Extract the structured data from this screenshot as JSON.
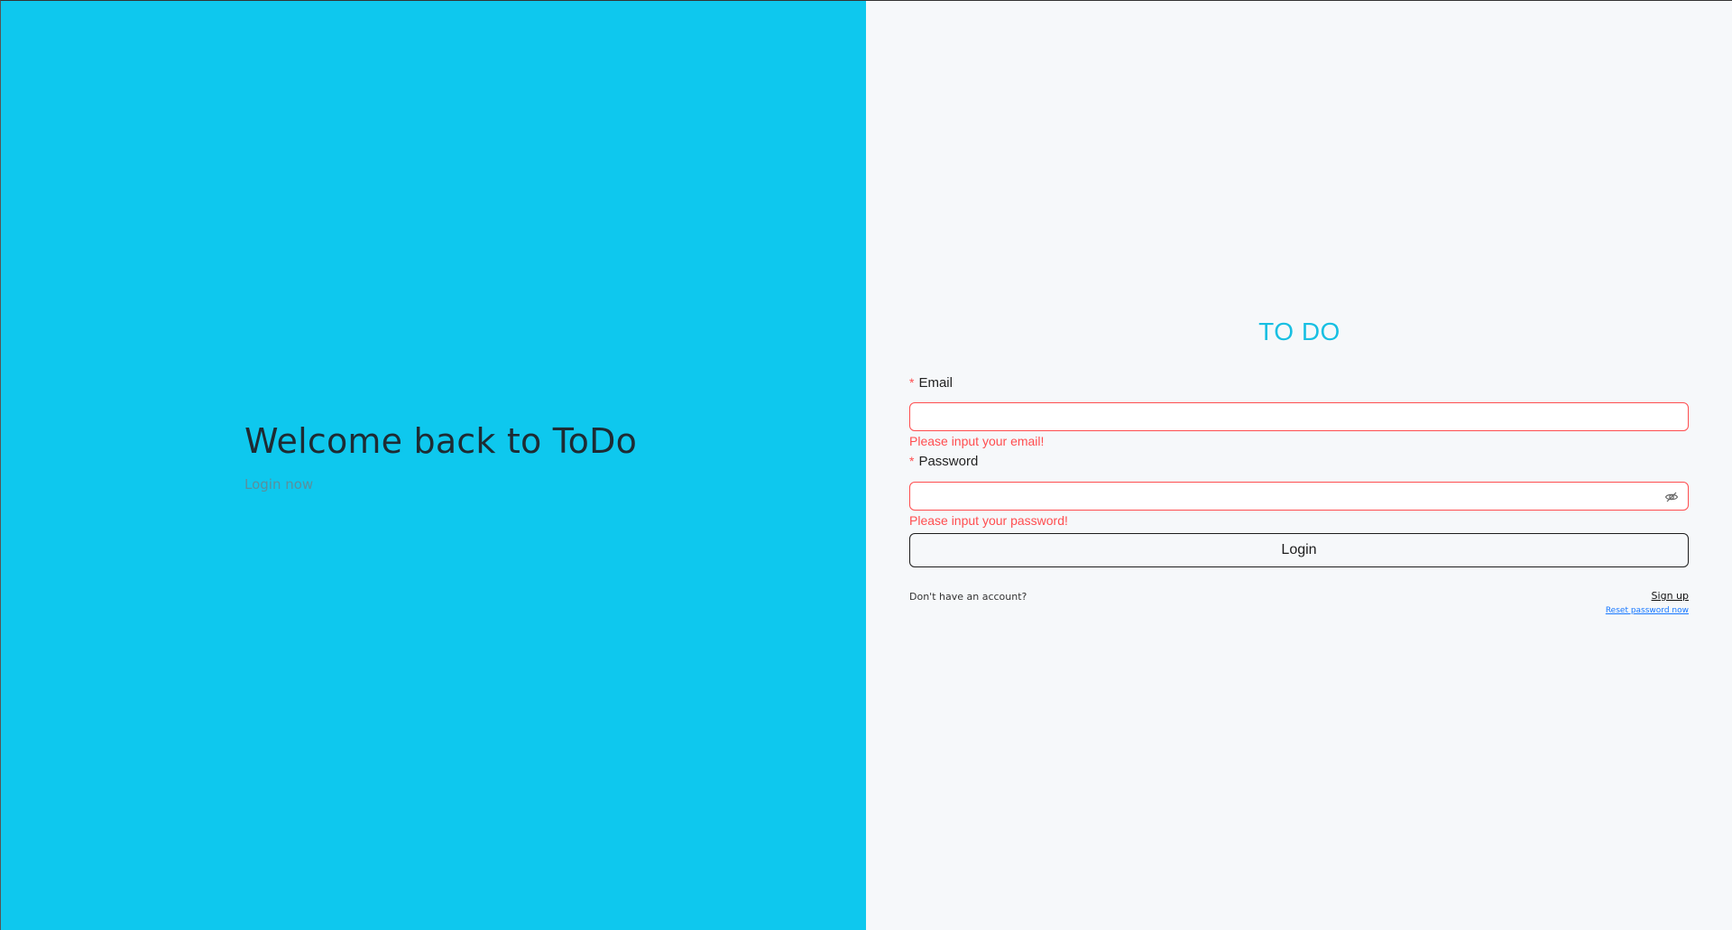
{
  "left": {
    "title": "Welcome back to ToDo",
    "subtitle": "Login now",
    "background": "#0ec8ee"
  },
  "brand": {
    "title": "TO DO",
    "color": "#17bfe2"
  },
  "form": {
    "email": {
      "label": "Email",
      "required_mark": "*",
      "value": "",
      "placeholder": "",
      "error": "Please input your email!"
    },
    "password": {
      "label": "Password",
      "required_mark": "*",
      "value": "",
      "placeholder": "",
      "error": "Please input your password!",
      "toggle_icon": "eye-invisible-icon"
    },
    "login_label": "Login",
    "no_account_text": "Don't have an account?",
    "signup_label": "Sign up",
    "reset_label": "Reset password now"
  },
  "colors": {
    "error": "#ff4d4f",
    "link": "#1677ff"
  }
}
